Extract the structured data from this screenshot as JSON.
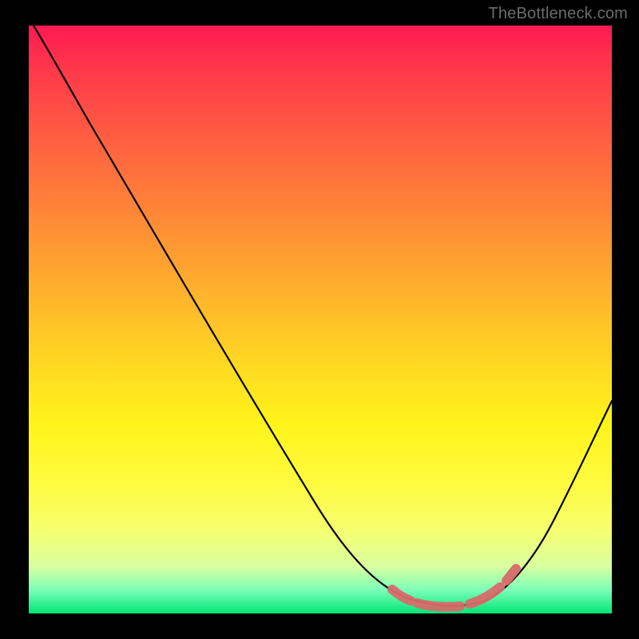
{
  "watermark": "TheBottleneck.com",
  "chart_data": {
    "type": "line",
    "title": "",
    "xlabel": "",
    "ylabel": "",
    "x": [
      0.0,
      0.05,
      0.1,
      0.15,
      0.2,
      0.25,
      0.3,
      0.35,
      0.4,
      0.45,
      0.5,
      0.55,
      0.6,
      0.63,
      0.66,
      0.7,
      0.74,
      0.78,
      0.82,
      0.86,
      0.9,
      0.94,
      0.98,
      1.0
    ],
    "values": [
      1.0,
      0.96,
      0.88,
      0.8,
      0.72,
      0.64,
      0.56,
      0.48,
      0.4,
      0.32,
      0.24,
      0.16,
      0.08,
      0.04,
      0.02,
      0.0,
      0.0,
      0.0,
      0.01,
      0.04,
      0.1,
      0.18,
      0.28,
      0.34
    ],
    "xlim": [
      0,
      1
    ],
    "ylim": [
      0,
      1
    ],
    "annotations": {
      "valley_range_x": [
        0.63,
        0.84
      ],
      "valley_marker_color": "#d86a6a"
    },
    "background_gradient": {
      "direction": "vertical",
      "stops": [
        {
          "pos": 0.0,
          "color": "#ff1a52"
        },
        {
          "pos": 0.5,
          "color": "#ffda22"
        },
        {
          "pos": 0.85,
          "color": "#f5ff70"
        },
        {
          "pos": 1.0,
          "color": "#00e676"
        }
      ]
    }
  }
}
